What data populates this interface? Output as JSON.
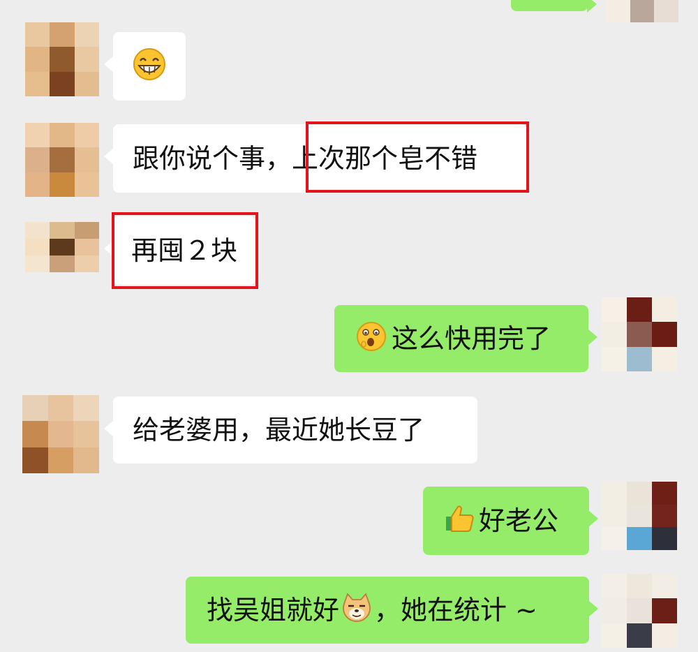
{
  "chat": {
    "messages": [
      {
        "id": "m1",
        "side": "left",
        "emoji": "grinning-face-icon",
        "text": ""
      },
      {
        "id": "m2",
        "side": "left",
        "text_a": "跟你说个事，",
        "text_b": "上次那个皂不错",
        "highlight": "上次那个皂不错"
      },
      {
        "id": "m3",
        "side": "left",
        "text": "再囤２块",
        "highlight": "再囤２块"
      },
      {
        "id": "m4",
        "side": "right",
        "emoji": "surprised-face-icon",
        "text": "这么快用完了"
      },
      {
        "id": "m5",
        "side": "left",
        "text": "给老婆用，最近她长豆了"
      },
      {
        "id": "m6",
        "side": "right",
        "emoji": "thumbs-up-icon",
        "text": "好老公"
      },
      {
        "id": "m7",
        "side": "right",
        "text_a": "找吴姐就好",
        "emoji": "doge-icon",
        "text_b": "，她在统计 ~"
      }
    ]
  },
  "colors": {
    "background": "#ededed",
    "incoming_bubble": "#ffffff",
    "outgoing_bubble": "#95ec69",
    "highlight_border": "#e3141b"
  }
}
